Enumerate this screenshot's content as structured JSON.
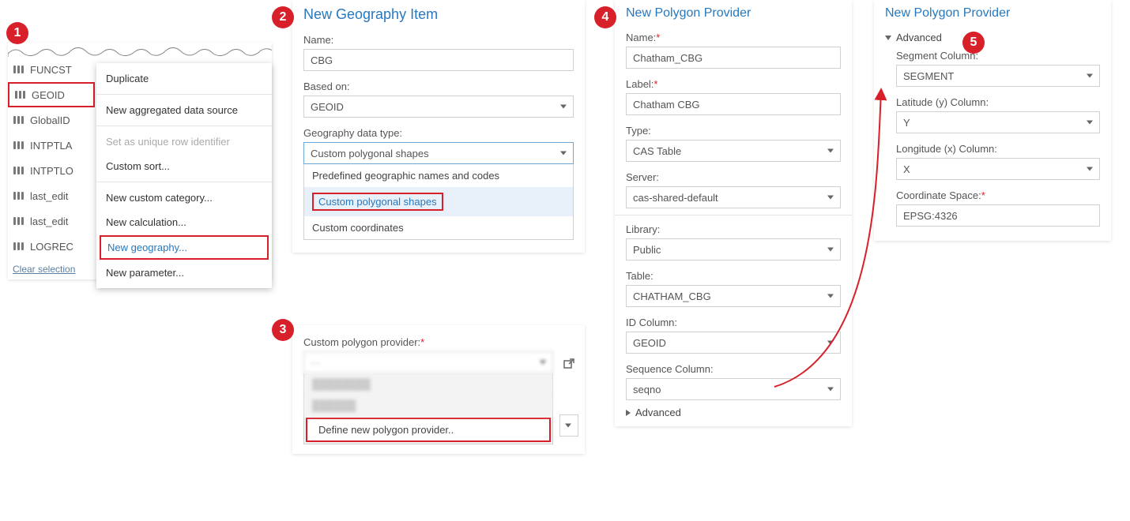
{
  "badges": {
    "b1": "1",
    "b2": "2",
    "b3": "3",
    "b4": "4",
    "b5": "5"
  },
  "panel1": {
    "columns": [
      "FUNCST",
      "GEOID",
      "GlobalID",
      "INTPTLA",
      "INTPTLO",
      "last_edit",
      "last_edit",
      "LOGREC"
    ],
    "clear": "Clear selection",
    "menu": {
      "duplicate": "Duplicate",
      "newAgg": "New aggregated data source",
      "setUnique": "Set as unique row identifier",
      "customSort": "Custom sort...",
      "newCat": "New custom category...",
      "newCalc": "New calculation...",
      "newGeo": "New geography...",
      "newParam": "New parameter..."
    }
  },
  "panel2": {
    "title": "New Geography Item",
    "nameLabel": "Name:",
    "nameValue": "CBG",
    "basedLabel": "Based on:",
    "basedValue": "GEOID",
    "geoTypeLabel": "Geography data type:",
    "geoTypeValue": "Custom polygonal shapes",
    "optPredefined": "Predefined geographic names and codes",
    "optCustomPoly": "Custom polygonal shapes",
    "optCustomCoord": "Custom coordinates"
  },
  "panel3": {
    "label": "Custom polygon provider:",
    "define": "Define new polygon provider.."
  },
  "panel4": {
    "title": "New Polygon Provider",
    "nameLabel": "Name:",
    "nameValue": "Chatham_CBG",
    "labelLabel": "Label:",
    "labelValue": "Chatham CBG",
    "typeLabel": "Type:",
    "typeValue": "CAS Table",
    "serverLabel": "Server:",
    "serverValue": "cas-shared-default",
    "libraryLabel": "Library:",
    "libraryValue": "Public",
    "tableLabel": "Table:",
    "tableValue": "CHATHAM_CBG",
    "idLabel": "ID Column:",
    "idValue": "GEOID",
    "seqLabel": "Sequence Column:",
    "seqValue": "seqno",
    "advanced": "Advanced"
  },
  "panel5": {
    "title": "New Polygon Provider",
    "advanced": "Advanced",
    "segLabel": "Segment Column:",
    "segValue": "SEGMENT",
    "latLabel": "Latitude (y) Column:",
    "latValue": "Y",
    "lonLabel": "Longitude (x) Column:",
    "lonValue": "X",
    "coordLabel": "Coordinate Space:",
    "coordValue": "EPSG:4326"
  }
}
